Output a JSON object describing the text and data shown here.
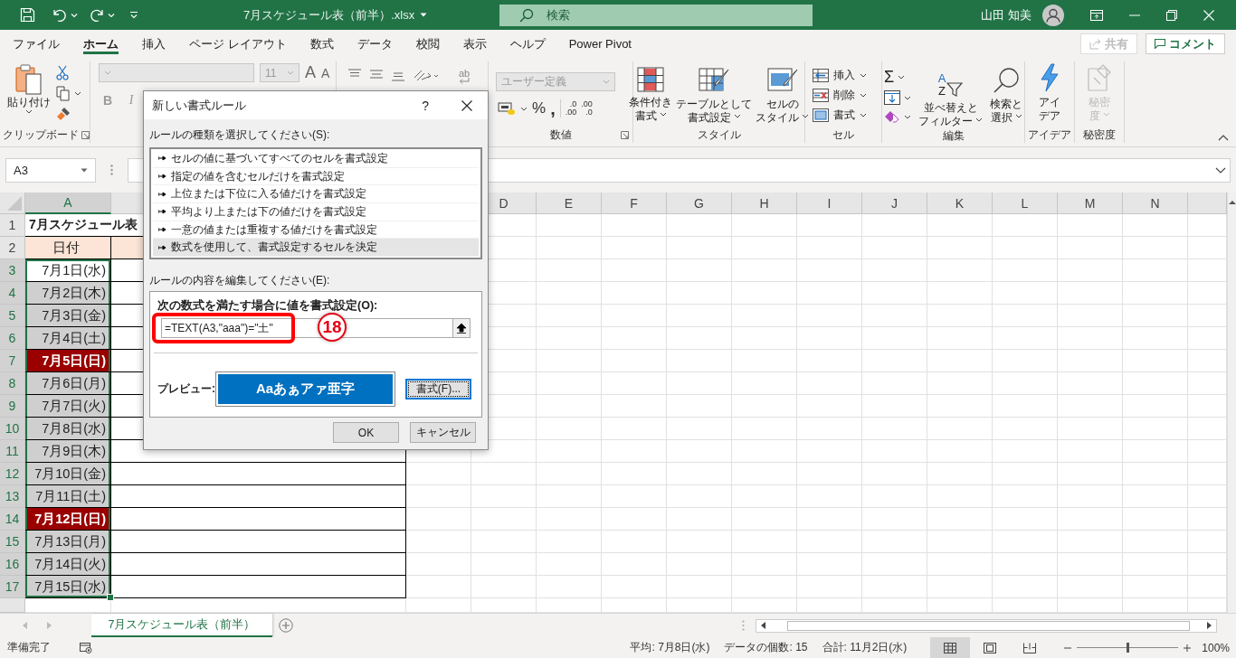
{
  "titlebar": {
    "title": "7月スケジュール表（前半）.xlsx",
    "search_placeholder": "検索",
    "user": "山田 知美"
  },
  "menu_tabs": [
    {
      "label": "ファイル",
      "selected": false
    },
    {
      "label": "ホーム",
      "selected": true
    },
    {
      "label": "挿入",
      "selected": false
    },
    {
      "label": "ページ レイアウト",
      "selected": false
    },
    {
      "label": "数式",
      "selected": false
    },
    {
      "label": "データ",
      "selected": false
    },
    {
      "label": "校閲",
      "selected": false
    },
    {
      "label": "表示",
      "selected": false
    },
    {
      "label": "ヘルプ",
      "selected": false
    },
    {
      "label": "Power Pivot",
      "selected": false
    }
  ],
  "share": {
    "label": "共有",
    "disabled": true
  },
  "comment": {
    "label": "コメント"
  },
  "ribbon": {
    "clipboard": {
      "paste": "貼り付け",
      "label": "クリップボード"
    },
    "font": {
      "size": "11",
      "bold": "B",
      "italic": "I",
      "grow": "A",
      "shrink": "A"
    },
    "alignment": {
      "wrap": "ab"
    },
    "number": {
      "format": "ユーザー定義",
      "percent": "%",
      "comma": ",",
      "label": "数値",
      "decimals": [
        {
          "top": ".0",
          "bottom": ".00"
        },
        {
          "top": ".00",
          "bottom": ".0"
        }
      ]
    },
    "styles": {
      "label": "スタイル",
      "buttons": [
        {
          "kind": "conditional",
          "line1": "条件付き",
          "line2": "書式"
        },
        {
          "kind": "table",
          "line1": "テーブルとして",
          "line2": "書式設定"
        },
        {
          "kind": "cellstyle",
          "line1": "セルの",
          "line2": "スタイル"
        }
      ]
    },
    "cells": {
      "label": "セル",
      "buttons": [
        {
          "kind": "insert",
          "label": "挿入"
        },
        {
          "kind": "delete",
          "label": "削除"
        },
        {
          "kind": "format",
          "label": "書式"
        }
      ]
    },
    "editing": {
      "label": "編集",
      "sum": "Σ",
      "sort": {
        "a": "A",
        "z": "Z",
        "line1": "並べ替えと",
        "line2": "フィルター"
      },
      "find": {
        "line1": "検索と",
        "line2": "選択"
      }
    },
    "ideas": {
      "line1": "アイ",
      "line2": "デア",
      "label": "アイデア"
    },
    "sensitivity": {
      "line1": "秘密",
      "line2": "度",
      "label": "秘密度",
      "disabled": true
    }
  },
  "name_box": "A3",
  "dialog": {
    "title": "新しい書式ルール",
    "help": "?",
    "type_label": "ルールの種類を選択してください(S):",
    "rules": [
      {
        "label": "セルの値に基づいてすべてのセルを書式設定",
        "selected": false
      },
      {
        "label": "指定の値を含むセルだけを書式設定",
        "selected": false
      },
      {
        "label": "上位または下位に入る値だけを書式設定",
        "selected": false
      },
      {
        "label": "平均より上または下の値だけを書式設定",
        "selected": false
      },
      {
        "label": "一意の値または重複する値だけを書式設定",
        "selected": false
      },
      {
        "label": "数式を使用して、書式設定するセルを決定",
        "selected": true
      }
    ],
    "edit_label": "ルールの内容を編集してください(E):",
    "formula_label": "次の数式を満たす場合に値を書式設定(O):",
    "formula": "=TEXT(A3,\"aaa\")=\"土\"",
    "step": "18",
    "preview_label": "プレビュー:",
    "preview": "Aaあぁアァ亜字",
    "format_button": "書式(F)...",
    "ok": "OK",
    "cancel": "キャンセル"
  },
  "columns": [
    {
      "label": "A",
      "selected": true
    },
    {
      "label": "D",
      "selected": false
    },
    {
      "label": "E",
      "selected": false
    },
    {
      "label": "F",
      "selected": false
    },
    {
      "label": "G",
      "selected": false
    },
    {
      "label": "H",
      "selected": false
    },
    {
      "label": "I",
      "selected": false
    },
    {
      "label": "J",
      "selected": false
    },
    {
      "label": "K",
      "selected": false
    },
    {
      "label": "L",
      "selected": false
    },
    {
      "label": "M",
      "selected": false
    },
    {
      "label": "N",
      "selected": false
    }
  ],
  "rows": [
    {
      "num": "1",
      "a": "7月スケジュール表",
      "kind": "title",
      "selected": false
    },
    {
      "num": "2",
      "a": "日付",
      "kind": "header",
      "selected": false
    },
    {
      "num": "3",
      "a": "7月1日(水)",
      "kind": "plain",
      "selected": true
    },
    {
      "num": "4",
      "a": "7月2日(木)",
      "kind": "gray",
      "selected": true
    },
    {
      "num": "5",
      "a": "7月3日(金)",
      "kind": "gray",
      "selected": true
    },
    {
      "num": "6",
      "a": "7月4日(土)",
      "kind": "gray",
      "selected": true
    },
    {
      "num": "7",
      "a": "7月5日(日)",
      "kind": "sunday",
      "selected": true
    },
    {
      "num": "8",
      "a": "7月6日(月)",
      "kind": "gray",
      "selected": true
    },
    {
      "num": "9",
      "a": "7月7日(火)",
      "kind": "gray",
      "selected": true
    },
    {
      "num": "10",
      "a": "7月8日(水)",
      "kind": "gray",
      "selected": true
    },
    {
      "num": "11",
      "a": "7月9日(木)",
      "kind": "gray",
      "selected": true
    },
    {
      "num": "12",
      "a": "7月10日(金)",
      "kind": "gray",
      "selected": true
    },
    {
      "num": "13",
      "a": "7月11日(土)",
      "kind": "gray",
      "selected": true
    },
    {
      "num": "14",
      "a": "7月12日(日)",
      "kind": "sunday",
      "selected": true
    },
    {
      "num": "15",
      "a": "7月13日(月)",
      "kind": "gray",
      "selected": true
    },
    {
      "num": "16",
      "a": "7月14日(火)",
      "kind": "gray",
      "selected": true
    },
    {
      "num": "17",
      "a": "7月15日(水)",
      "kind": "gray",
      "selected": true
    }
  ],
  "sheet_tabs": [
    {
      "label": "7月スケジュール表（前半）",
      "selected": true
    }
  ],
  "status": {
    "ready": "準備完了",
    "average": "平均: 7月8日(水)",
    "count": "データの個数: 15",
    "sum": "合計: 11月2日(水)",
    "views": [
      {
        "kind": "normal",
        "selected": true
      },
      {
        "kind": "page_layout",
        "selected": false
      },
      {
        "kind": "page_break",
        "selected": false
      }
    ],
    "zoom": {
      "level": 0.5,
      "reading": "100%"
    }
  }
}
